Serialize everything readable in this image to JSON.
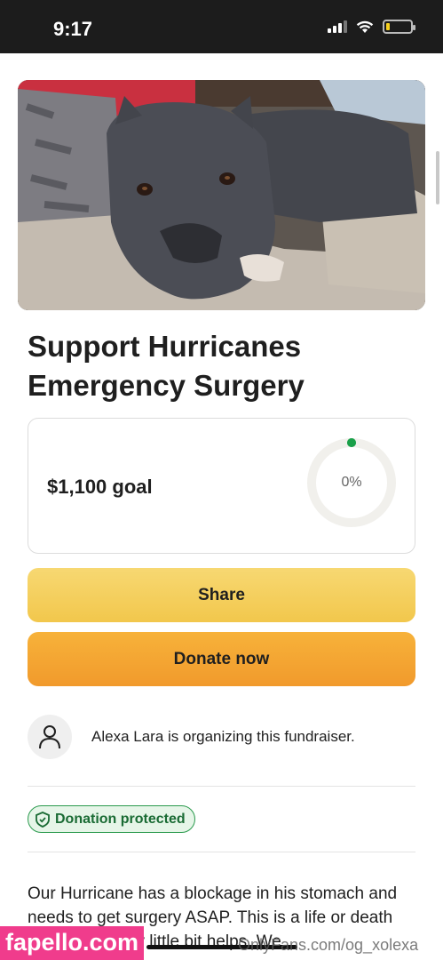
{
  "status_bar": {
    "time": "9:17",
    "icons": [
      "signal-icon",
      "wifi-icon",
      "battery-icon"
    ],
    "battery_level": 0.15,
    "battery_color": "#f5d020"
  },
  "hero": {
    "image_icon": "dog-photo"
  },
  "fundraiser": {
    "title": "Support Hurricanes Emergency Surgery",
    "goal_text": "$1,100 goal",
    "progress_label": "0%",
    "progress_fraction": 0.0,
    "progress_color": "#1aa04a"
  },
  "actions": {
    "share_label": "Share",
    "donate_label": "Donate now",
    "share_color": "#f4cd5a",
    "donate_color": "#f5a634"
  },
  "organizer": {
    "text": "Alexa Lara is organizing this fundraiser.",
    "avatar_icon": "user-icon"
  },
  "protection": {
    "label": "Donation protected",
    "icon": "shield-check-icon",
    "color": "#2a9a4d"
  },
  "story": {
    "text": "Our Hurricane has a blockage in his stomach and needs to get surgery ASAP. This is a life or death situation so any little bit helps. We"
  },
  "watermarks": {
    "left": "fapello.com",
    "right": "OnlyFans.com/og_xolexa"
  }
}
